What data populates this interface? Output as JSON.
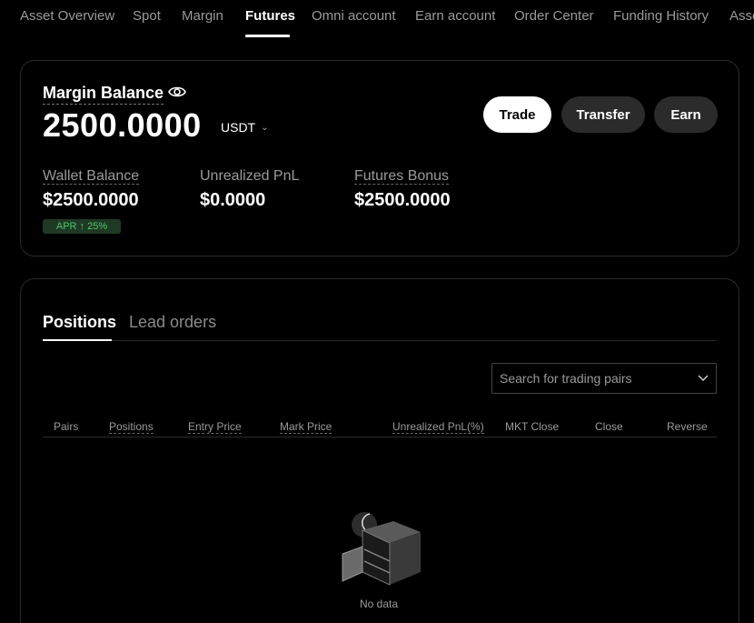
{
  "nav": {
    "tabs": [
      {
        "label": "Asset Overview"
      },
      {
        "label": "Spot"
      },
      {
        "label": "Margin"
      },
      {
        "label": "Futures"
      },
      {
        "label": "Omni account"
      },
      {
        "label": "Earn account"
      },
      {
        "label": "Order Center"
      },
      {
        "label": "Funding History"
      },
      {
        "label": "Asse"
      }
    ],
    "active": "Futures"
  },
  "balance": {
    "title": "Margin Balance",
    "amount": "2500.0000",
    "currency": "USDT",
    "buttons": {
      "trade": "Trade",
      "transfer": "Transfer",
      "earn": "Earn"
    },
    "stats": [
      {
        "label": "Wallet Balance",
        "value": "$2500.0000"
      },
      {
        "label": "Unrealized PnL",
        "value": "$0.0000"
      },
      {
        "label": "Futures Bonus",
        "value": "$2500.0000"
      }
    ],
    "apr_badge": "APR ↑ 25%"
  },
  "positions": {
    "tabs": [
      {
        "label": "Positions"
      },
      {
        "label": "Lead orders"
      }
    ],
    "search_placeholder": "Search for trading pairs",
    "columns": [
      "Pairs",
      "Positions",
      "Entry Price",
      "Mark Price",
      "Unrealized PnL(%)",
      "MKT Close",
      "Close",
      "Reverse"
    ],
    "empty_text": "No data"
  },
  "colors": {
    "background": "#000000",
    "accent_green": "#4fc26b",
    "button_dark": "#2b2b2b"
  },
  "icons": {
    "eye": "eye-icon",
    "chevron": "chevron-down-icon",
    "empty": "empty-box-icon"
  }
}
